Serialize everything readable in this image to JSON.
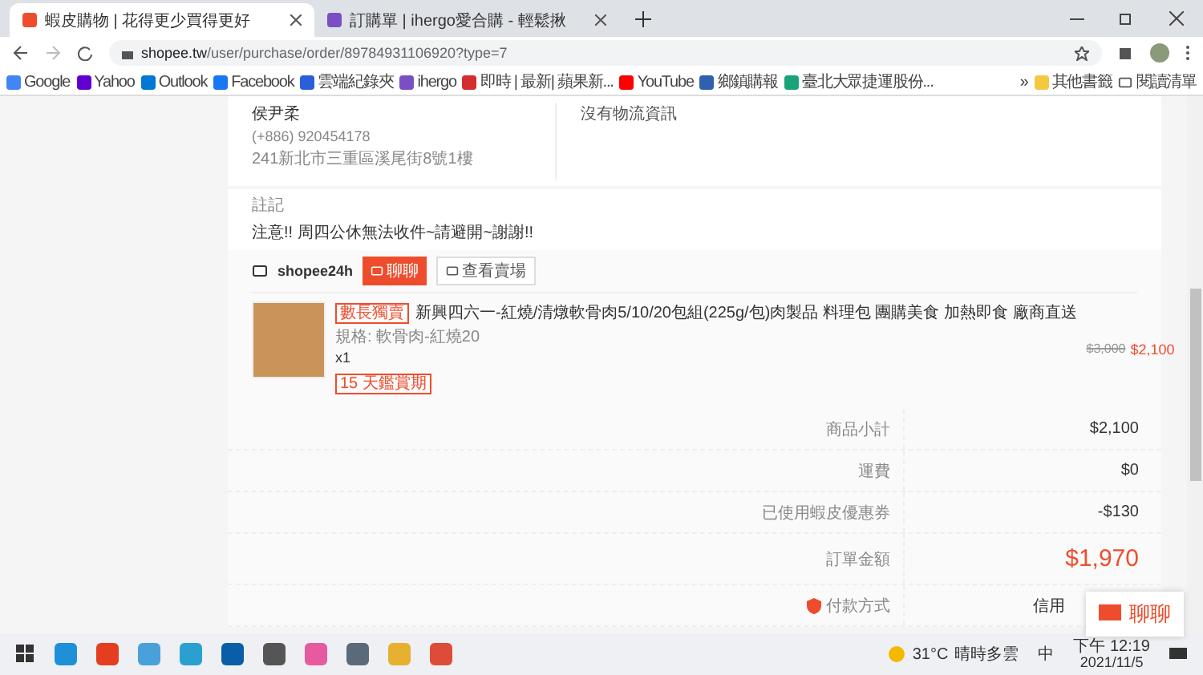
{
  "browser": {
    "tabs": [
      {
        "title": "蝦皮購物 | 花得更少買得更好",
        "selected": true,
        "color": "#ee4d2d"
      },
      {
        "title": "訂購單 | ihergo愛合購 - 輕鬆揪",
        "selected": false,
        "color": "#7b4fc4"
      }
    ],
    "url_host": "shopee.tw",
    "url_path": "/user/purchase/order/89784931106920?type=7",
    "bookmarks": [
      {
        "label": "Google",
        "color": "#4285f4"
      },
      {
        "label": "Yahoo",
        "color": "#6001d2"
      },
      {
        "label": "Outlook",
        "color": "#0078d4"
      },
      {
        "label": "Facebook",
        "color": "#1877f2"
      },
      {
        "label": "雲端紀錄夾",
        "color": "#2b5fd9"
      },
      {
        "label": "ihergo",
        "color": "#7b4fc4"
      },
      {
        "label": "即時 | 最新| 蘋果新...",
        "color": "#d32f2f"
      },
      {
        "label": "YouTube",
        "color": "#ff0000"
      },
      {
        "label": "鄉鎮購報",
        "color": "#3060b0"
      },
      {
        "label": "臺北大眾捷運股份...",
        "color": "#1aa37a"
      }
    ],
    "bookmarks_more": "»",
    "other_bookmarks": "其他書籤",
    "reading_list": "閱讀清單"
  },
  "address": {
    "name": "侯尹柔",
    "phone": "(+886) 920454178",
    "street": "241新北市三重區溪尾街8號1樓"
  },
  "logistics": "沒有物流資訊",
  "note": {
    "label": "註記",
    "text": "注意!! 周四公休無法收件~請避開~謝謝!!"
  },
  "shop": {
    "name": "shopee24h",
    "chat_button": "聊聊",
    "view_button": "查看賣場"
  },
  "item": {
    "badge": "數長獨賣",
    "title": "新興四六一-紅燒/清燉軟骨肉5/10/20包組(225g/包)肉製品 料理包 團購美食 加熱即食 廠商直送",
    "variation": "規格: 軟骨肉-紅燒20",
    "quantity": "x1",
    "return_tag": "15 天鑑賞期",
    "original_price": "$3,000",
    "price": "$2,100"
  },
  "summary": [
    {
      "label": "商品小計",
      "value": "$2,100",
      "kind": "plain"
    },
    {
      "label": "運費",
      "value": "$0",
      "kind": "plain"
    },
    {
      "label": "已使用蝦皮優惠券",
      "value": "-$130",
      "kind": "plain"
    },
    {
      "label": "訂單金額",
      "value": "$1,970",
      "kind": "total"
    },
    {
      "label": "付款方式",
      "value": "信用",
      "kind": "payment"
    }
  ],
  "chat_fab": "聊聊",
  "taskbar": {
    "weather": "31°C",
    "weather_text": "晴時多雲",
    "ime": "中",
    "time": "下午 12:19",
    "date": "2021/11/5"
  }
}
